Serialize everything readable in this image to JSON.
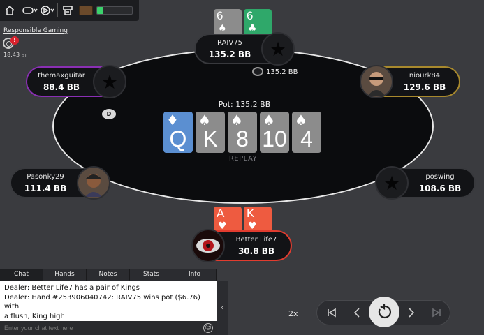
{
  "toolbar": {
    "icons": [
      "home-icon",
      "toggle-icon",
      "play-menu-icon",
      "cashier-icon",
      "chest-icon"
    ],
    "level_meter": 0.15,
    "accent": "#3bd36c"
  },
  "responsible_gaming": "Responsible Gaming",
  "notification_count": "!",
  "clock": {
    "time": "18:43",
    "zone": "JST"
  },
  "table": {
    "pot": "Pot: 135.2 BB",
    "replay_label": "REPLAY",
    "board": [
      {
        "rank": "Q",
        "suit": "♦",
        "color": "#5b8fd1"
      },
      {
        "rank": "K",
        "suit": "♠",
        "color": "#8c8c8c"
      },
      {
        "rank": "8",
        "suit": "♠",
        "color": "#8c8c8c"
      },
      {
        "rank": "10",
        "suit": "♠",
        "color": "#8c8c8c"
      },
      {
        "rank": "4",
        "suit": "♠",
        "color": "#8c8c8c"
      }
    ],
    "dealer_button": "D",
    "bet": "135.2 BB"
  },
  "seats": [
    {
      "name": "RAIV75",
      "stack": "135.2 BB",
      "cards": [
        {
          "rank": "6",
          "suit": "♠",
          "color": "#8c8c8c"
        },
        {
          "rank": "6",
          "suit": "♣",
          "color": "#2fa86a"
        }
      ]
    },
    {
      "name": "niourk84",
      "stack": "129.6 BB"
    },
    {
      "name": "poswing",
      "stack": "108.6 BB"
    },
    {
      "name": "Better Life7",
      "stack": "30.8 BB",
      "cards": [
        {
          "rank": "A",
          "suit": "♥",
          "color": "#ee5b40"
        },
        {
          "rank": "K",
          "suit": "♥",
          "color": "#ee5b40"
        }
      ]
    },
    {
      "name": "Pasonky29",
      "stack": "111.4 BB"
    },
    {
      "name": "themaxguitar",
      "stack": "88.4 BB"
    }
  ],
  "chat": {
    "tabs": [
      "Chat",
      "Hands",
      "Notes",
      "Stats",
      "Info"
    ],
    "lines": [
      "Dealer: Better Life7 has a pair of Kings",
      "Dealer: Hand #253906040742: RAIV75 wins pot ($6.76) with",
      " a flush, King high"
    ],
    "placeholder": "Enter your chat text here",
    "collapse": "‹"
  },
  "replay": {
    "speed": "2x"
  }
}
